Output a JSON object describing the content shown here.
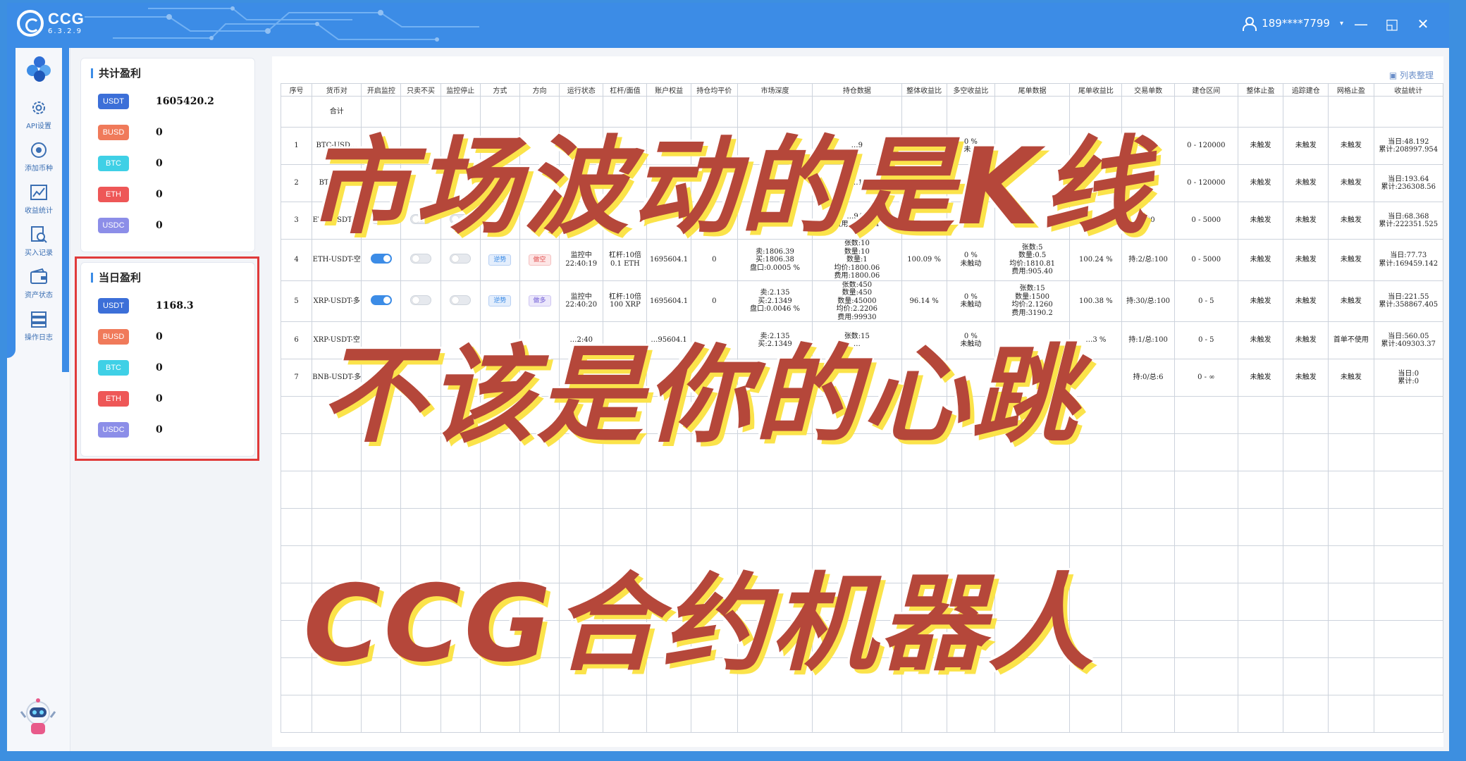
{
  "app": {
    "name": "CCG",
    "version": "6.3.2.9"
  },
  "user": {
    "phone": "189****7799"
  },
  "window_controls": {
    "minimize": "—",
    "maximize": "◱",
    "close": "✕"
  },
  "sidebar": {
    "items": [
      {
        "label": "API设置",
        "icon": "gear-icon"
      },
      {
        "label": "添加币种",
        "icon": "target-icon"
      },
      {
        "label": "收益统计",
        "icon": "chart-icon"
      },
      {
        "label": "买入记录",
        "icon": "search-doc-icon"
      },
      {
        "label": "资产状态",
        "icon": "wallet-icon"
      },
      {
        "label": "操作日志",
        "icon": "list-icon"
      }
    ]
  },
  "total_profit": {
    "title": "共计盈利",
    "rows": [
      {
        "coin": "USDT",
        "value": "1605420.2",
        "color": "#3c6fd8"
      },
      {
        "coin": "BUSD",
        "value": "0",
        "color": "#f07a5a"
      },
      {
        "coin": "BTC",
        "value": "0",
        "color": "#3fd0e6"
      },
      {
        "coin": "ETH",
        "value": "0",
        "color": "#ee5757"
      },
      {
        "coin": "USDC",
        "value": "0",
        "color": "#8c8ee8"
      }
    ]
  },
  "daily_profit": {
    "title": "当日盈利",
    "rows": [
      {
        "coin": "USDT",
        "value": "1168.3",
        "color": "#3c6fd8"
      },
      {
        "coin": "BUSD",
        "value": "0",
        "color": "#f07a5a"
      },
      {
        "coin": "BTC",
        "value": "0",
        "color": "#3fd0e6"
      },
      {
        "coin": "ETH",
        "value": "0",
        "color": "#ee5757"
      },
      {
        "coin": "USDC",
        "value": "0",
        "color": "#8c8ee8"
      }
    ]
  },
  "table": {
    "list_link": "▣ 列表整理",
    "headers": [
      "序号",
      "货币对",
      "开启监控",
      "只卖不买",
      "监控停止",
      "方式",
      "方向",
      "运行状态",
      "杠杆/面值",
      "账户权益",
      "持仓均平价",
      "市场深度",
      "持仓数据",
      "整体收益比",
      "多空收益比",
      "尾单数据",
      "尾单收益比",
      "交易单数",
      "建仓区间",
      "整体止盈",
      "追踪建仓",
      "网格止盈",
      "收益统计"
    ],
    "sum_label": "合计",
    "rows": [
      {
        "no": "1",
        "pair": "BTC-USD…",
        "range": "0 - 120000",
        "tp": "未触发",
        "track": "未触发",
        "grid": "未触发",
        "stats": "当日:48.192\n累计:208997.954",
        "col12": "…9",
        "col14": "0 %\n未…",
        "col17": "0"
      },
      {
        "no": "2",
        "pair": "BTC-US…",
        "range": "0 - 120000",
        "tp": "未触发",
        "track": "未触发",
        "grid": "未触发",
        "stats": "当日:193.64\n累计:236308.56",
        "col12": "…1",
        "col14": "",
        "col17": "0"
      },
      {
        "no": "3",
        "pair": "ETH-USDT-多",
        "range": "0 - 5000",
        "tp": "未触发",
        "track": "未触发",
        "grid": "未触发",
        "stats": "当日:68.368\n累计:222351.525",
        "col12": "…942\n费用:1466.61",
        "col14": "未触动",
        "col17": "100"
      },
      {
        "no": "4",
        "pair": "ETH-USDT-空",
        "mode": "逆势",
        "dir": "做空",
        "status": "监控中\n22:40:19",
        "lev": "杠杆:10倍\n0.1 ETH",
        "equity": "1695604.1",
        "avg": "0",
        "depth": "卖:1806.39\n买:1806.38\n盘口:0.0005 %",
        "hold": "张数:10\n数量:10\n数量:1\n均价:1800.06\n费用:1800.06",
        "whole": "100.09 %",
        "ls": "0 %\n未触动",
        "tail": "张数:5\n数量:0.5\n均价:1810.81\n费用:905.40",
        "tailr": "100.24 %",
        "trades": "持:2/总:100",
        "range": "0 - 5000",
        "tp": "未触发",
        "track": "未触发",
        "grid": "未触发",
        "stats": "当日:77.73\n累计:169459.142"
      },
      {
        "no": "5",
        "pair": "XRP-USDT-多",
        "mode": "逆势",
        "dir": "做多",
        "status": "监控中\n22:40:20",
        "lev": "杠杆:10倍\n100 XRP",
        "equity": "1695604.1",
        "avg": "0",
        "depth": "卖:2.135\n买:2.1349\n盘口:0.0046 %",
        "hold": "张数:450\n数量:450\n数量:45000\n均价:2.2206\n费用:99930",
        "whole": "96.14 %",
        "ls": "0 %\n未触动",
        "tail": "张数:15\n数量:1500\n均价:2.1260\n费用:3190.2",
        "tailr": "100.38 %",
        "trades": "持:30/总:100",
        "range": "0 - 5",
        "tp": "未触发",
        "track": "未触发",
        "grid": "未触发",
        "stats": "当日:221.55\n累计:358867.405"
      },
      {
        "no": "6",
        "pair": "XRP-USDT-空",
        "status": "…2:40",
        "equity": "…95604.1",
        "depth": "卖:2.135\n买:2.1349",
        "hold": "张数:15\n…",
        "ls": "0 %\n未触动",
        "tailr": "…3 %",
        "trades": "持:1/总:100",
        "range": "0 - 5",
        "tp": "未触发",
        "track": "未触发",
        "grid": "首单不使用",
        "stats": "当日:560.05\n累计:409303.37"
      },
      {
        "no": "7",
        "pair": "BNB-USDT-多",
        "trades": "持:0/总:6",
        "range": "0 - ∞",
        "tp": "未触发",
        "track": "未触发",
        "grid": "未触发",
        "stats": "当日:0\n累计:0"
      }
    ]
  },
  "overlay": {
    "line1": "市场波动的是K线",
    "line2": "不该是你的心跳",
    "line3": "CCG合约机器人"
  }
}
